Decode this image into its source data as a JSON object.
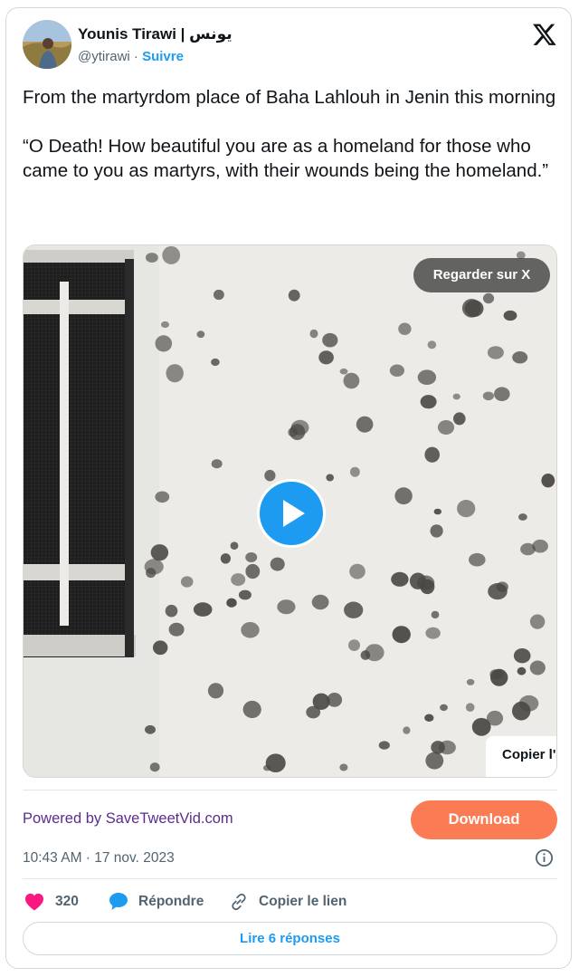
{
  "author": {
    "name": "Younis Tirawi | يونس",
    "handle": "@ytirawi",
    "separator": "·",
    "follow_label": "Suivre"
  },
  "tweet": {
    "paragraphs": [
      "From the martyrdom place of Baha Lahlouh in Jenin this morning",
      "“O Death! How beautiful you are as a homeland for those who came to you as martyrs, with their wounds being the homeland.”"
    ]
  },
  "media": {
    "watch_on_x_label": "Regarder sur X",
    "copy_popup_label": "Copier l'adresse"
  },
  "promo": {
    "powered_by": "Powered by SaveTweetVid.com",
    "download_label": "Download"
  },
  "meta": {
    "timestamp": "10:43 AM · 17 nov. 2023"
  },
  "actions": {
    "like_count": "320",
    "reply_label": "Répondre",
    "copy_link_label": "Copier le lien"
  },
  "footer": {
    "read_replies_label": "Lire 6 réponses"
  },
  "colors": {
    "accent": "#1d9bf0",
    "like": "#f91880",
    "download": "#fb7c54",
    "promo_text": "#5b2c8f"
  }
}
